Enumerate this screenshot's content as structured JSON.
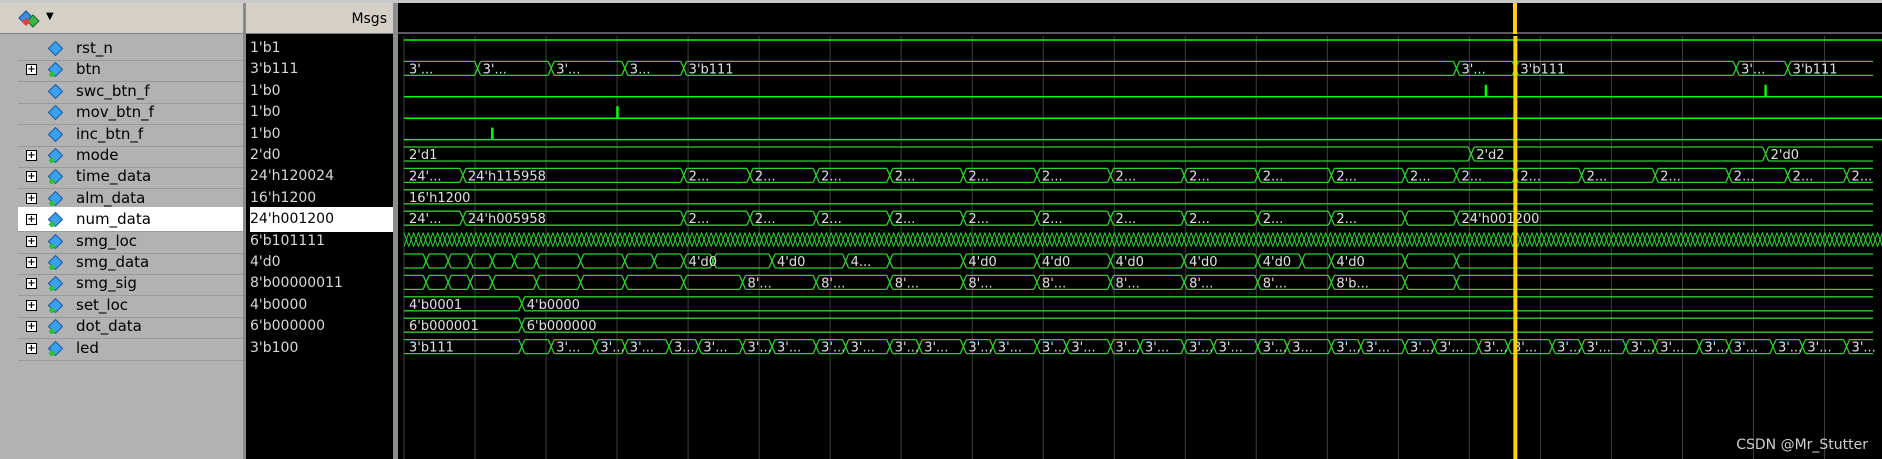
{
  "header": {
    "msgs_label": "Msgs"
  },
  "signals": [
    {
      "name": "rst_n",
      "value": "1'b1",
      "expandable": false,
      "icon": "single-bit-signal-icon",
      "selected": false
    },
    {
      "name": "btn",
      "value": "3'b111",
      "expandable": true,
      "icon": "bus-signal-icon",
      "selected": false
    },
    {
      "name": "swc_btn_f",
      "value": "1'b0",
      "expandable": false,
      "icon": "single-bit-signal-icon",
      "selected": false
    },
    {
      "name": "mov_btn_f",
      "value": "1'b0",
      "expandable": false,
      "icon": "single-bit-signal-icon",
      "selected": false
    },
    {
      "name": "inc_btn_f",
      "value": "1'b0",
      "expandable": false,
      "icon": "single-bit-signal-icon",
      "selected": false
    },
    {
      "name": "mode",
      "value": "2'd0",
      "expandable": true,
      "icon": "bus-signal-icon",
      "selected": false
    },
    {
      "name": "time_data",
      "value": "24'h120024",
      "expandable": true,
      "icon": "bus-signal-icon",
      "selected": false
    },
    {
      "name": "alm_data",
      "value": "16'h1200",
      "expandable": true,
      "icon": "bus-signal-icon",
      "selected": false
    },
    {
      "name": "num_data",
      "value": "24'h001200",
      "expandable": true,
      "icon": "bus-signal-icon",
      "selected": true
    },
    {
      "name": "smg_loc",
      "value": "6'b101111",
      "expandable": true,
      "icon": "bus-signal-icon",
      "selected": false
    },
    {
      "name": "smg_data",
      "value": "4'd0",
      "expandable": true,
      "icon": "bus-signal-icon",
      "selected": false
    },
    {
      "name": "smg_sig",
      "value": "8'b00000011",
      "expandable": true,
      "icon": "bus-signal-icon",
      "selected": false
    },
    {
      "name": "set_loc",
      "value": "4'b0000",
      "expandable": true,
      "icon": "bus-signal-icon",
      "selected": false
    },
    {
      "name": "dot_data",
      "value": "6'b000000",
      "expandable": true,
      "icon": "bus-signal-icon",
      "selected": false
    },
    {
      "name": "led",
      "value": "3'b100",
      "expandable": true,
      "icon": "bus-signal-icon",
      "selected": false
    }
  ],
  "waves": [
    {
      "kind": "high"
    },
    {
      "kind": "bus",
      "transitions": [
        0.05,
        0.1,
        0.15,
        0.19,
        0.715,
        0.755,
        0.905,
        0.94
      ],
      "labels": [
        [
          0.0,
          "3'..."
        ],
        [
          0.05,
          "3'..."
        ],
        [
          0.1,
          "3'..."
        ],
        [
          0.15,
          "3..."
        ],
        [
          0.19,
          "3'b111"
        ],
        [
          0.715,
          "3'..."
        ],
        [
          0.755,
          "3'b111"
        ],
        [
          0.905,
          "3'..."
        ],
        [
          0.94,
          "3'b111"
        ]
      ]
    },
    {
      "kind": "pulse",
      "pulses": [
        0.735,
        0.925
      ]
    },
    {
      "kind": "pulse",
      "pulses": [
        0.145
      ]
    },
    {
      "kind": "pulse",
      "pulses": [
        0.06
      ]
    },
    {
      "kind": "bus",
      "transitions": [
        0.725,
        0.925
      ],
      "labels": [
        [
          0.0,
          "2'd1"
        ],
        [
          0.725,
          "2'd2"
        ],
        [
          0.925,
          "2'd0"
        ]
      ]
    },
    {
      "kind": "bus",
      "transitions": [
        0.04,
        0.19,
        0.235,
        0.28,
        0.33,
        0.38,
        0.43,
        0.48,
        0.53,
        0.58,
        0.63,
        0.68,
        0.715,
        0.755,
        0.8,
        0.85,
        0.9,
        0.94,
        0.98
      ],
      "labels": [
        [
          0.0,
          "24'..."
        ],
        [
          0.04,
          "24'h115958"
        ],
        [
          0.19,
          "2..."
        ],
        [
          0.235,
          "2..."
        ],
        [
          0.28,
          "2..."
        ],
        [
          0.33,
          "2..."
        ],
        [
          0.38,
          "2..."
        ],
        [
          0.43,
          "2..."
        ],
        [
          0.48,
          "2..."
        ],
        [
          0.53,
          "2..."
        ],
        [
          0.58,
          "2..."
        ],
        [
          0.63,
          "2..."
        ],
        [
          0.68,
          "2..."
        ],
        [
          0.715,
          "2..."
        ],
        [
          0.755,
          "2..."
        ],
        [
          0.8,
          "2..."
        ],
        [
          0.85,
          "2..."
        ],
        [
          0.9,
          "2..."
        ],
        [
          0.94,
          "2..."
        ],
        [
          0.98,
          "2..."
        ]
      ]
    },
    {
      "kind": "bus",
      "transitions": [],
      "labels": [
        [
          0.0,
          "16'h1200"
        ]
      ]
    },
    {
      "kind": "bus",
      "transitions": [
        0.04,
        0.19,
        0.235,
        0.28,
        0.33,
        0.38,
        0.43,
        0.48,
        0.53,
        0.58,
        0.63,
        0.68,
        0.715
      ],
      "labels": [
        [
          0.0,
          "24'..."
        ],
        [
          0.04,
          "24'h005958"
        ],
        [
          0.19,
          "2..."
        ],
        [
          0.235,
          "2..."
        ],
        [
          0.28,
          "2..."
        ],
        [
          0.33,
          "2..."
        ],
        [
          0.38,
          "2..."
        ],
        [
          0.43,
          "2..."
        ],
        [
          0.48,
          "2..."
        ],
        [
          0.53,
          "2..."
        ],
        [
          0.58,
          "2..."
        ],
        [
          0.63,
          "2..."
        ],
        [
          0.715,
          "24'h001200"
        ]
      ]
    },
    {
      "kind": "dense"
    },
    {
      "kind": "bus",
      "transitions": [
        0.015,
        0.03,
        0.045,
        0.06,
        0.075,
        0.09,
        0.12,
        0.15,
        0.17,
        0.19,
        0.21,
        0.25,
        0.3,
        0.33,
        0.38,
        0.43,
        0.48,
        0.53,
        0.58,
        0.61,
        0.63,
        0.68,
        0.715
      ],
      "labels": [
        [
          0.19,
          "4'd0"
        ],
        [
          0.25,
          "4'd0"
        ],
        [
          0.3,
          "4..."
        ],
        [
          0.38,
          "4'd0"
        ],
        [
          0.43,
          "4'd0"
        ],
        [
          0.48,
          "4'd0"
        ],
        [
          0.53,
          "4'd0"
        ],
        [
          0.58,
          "4'd0"
        ],
        [
          0.63,
          "4'd0"
        ]
      ]
    },
    {
      "kind": "bus",
      "transitions": [
        0.015,
        0.03,
        0.045,
        0.06,
        0.09,
        0.12,
        0.15,
        0.19,
        0.23,
        0.28,
        0.33,
        0.38,
        0.43,
        0.48,
        0.53,
        0.58,
        0.63,
        0.68,
        0.715
      ],
      "labels": [
        [
          0.23,
          "8'..."
        ],
        [
          0.28,
          "8'..."
        ],
        [
          0.33,
          "8'..."
        ],
        [
          0.38,
          "8'..."
        ],
        [
          0.43,
          "8'..."
        ],
        [
          0.48,
          "8'..."
        ],
        [
          0.53,
          "8'..."
        ],
        [
          0.58,
          "8'..."
        ],
        [
          0.63,
          "8'b..."
        ]
      ]
    },
    {
      "kind": "bus",
      "transitions": [
        0.08
      ],
      "labels": [
        [
          0.0,
          "4'b0001"
        ],
        [
          0.08,
          "4'b0000"
        ]
      ]
    },
    {
      "kind": "bus",
      "transitions": [
        0.08
      ],
      "labels": [
        [
          0.0,
          "6'b000001"
        ],
        [
          0.08,
          "6'b000000"
        ]
      ]
    },
    {
      "kind": "bus",
      "transitions": [
        0.08,
        0.1,
        0.13,
        0.15,
        0.18,
        0.2,
        0.23,
        0.25,
        0.28,
        0.3,
        0.33,
        0.35,
        0.38,
        0.4,
        0.43,
        0.45,
        0.48,
        0.5,
        0.53,
        0.55,
        0.58,
        0.6,
        0.63,
        0.65,
        0.68,
        0.7,
        0.73,
        0.75,
        0.78,
        0.8,
        0.83,
        0.85,
        0.88,
        0.9,
        0.93,
        0.95,
        0.98
      ],
      "labels": [
        [
          0.0,
          "3'b111"
        ],
        [
          0.1,
          "3'..."
        ],
        [
          0.13,
          "3'..."
        ],
        [
          0.15,
          "3'..."
        ],
        [
          0.18,
          "3..."
        ],
        [
          0.2,
          "3'..."
        ],
        [
          0.23,
          "3'..."
        ],
        [
          0.25,
          "3'..."
        ],
        [
          0.28,
          "3'..."
        ],
        [
          0.3,
          "3'..."
        ],
        [
          0.33,
          "3'..."
        ],
        [
          0.35,
          "3'..."
        ],
        [
          0.38,
          "3'..."
        ],
        [
          0.4,
          "3'..."
        ],
        [
          0.43,
          "3'..."
        ],
        [
          0.45,
          "3'..."
        ],
        [
          0.48,
          "3'..."
        ],
        [
          0.5,
          "3'..."
        ],
        [
          0.53,
          "3'..."
        ],
        [
          0.55,
          "3'..."
        ],
        [
          0.58,
          "3'..."
        ],
        [
          0.6,
          "3..."
        ],
        [
          0.63,
          "3'..."
        ],
        [
          0.65,
          "3'..."
        ],
        [
          0.68,
          "3'..."
        ],
        [
          0.7,
          "3'..."
        ],
        [
          0.73,
          "3'..."
        ],
        [
          0.75,
          "3'..."
        ],
        [
          0.78,
          "3'..."
        ],
        [
          0.8,
          "3'..."
        ],
        [
          0.83,
          "3'..."
        ],
        [
          0.85,
          "3'..."
        ],
        [
          0.88,
          "3'..."
        ],
        [
          0.9,
          "3'..."
        ],
        [
          0.93,
          "3'..."
        ],
        [
          0.95,
          "3'..."
        ],
        [
          0.98,
          "3'..."
        ]
      ]
    }
  ],
  "cursor_position": 0.755,
  "colors": {
    "wave": "#00ff00",
    "bus": "#2fd12f",
    "grid": "#404040",
    "cursor": "#ffd200",
    "label": "#e0e0e0"
  },
  "watermark": "CSDN @Mr_Stutter"
}
